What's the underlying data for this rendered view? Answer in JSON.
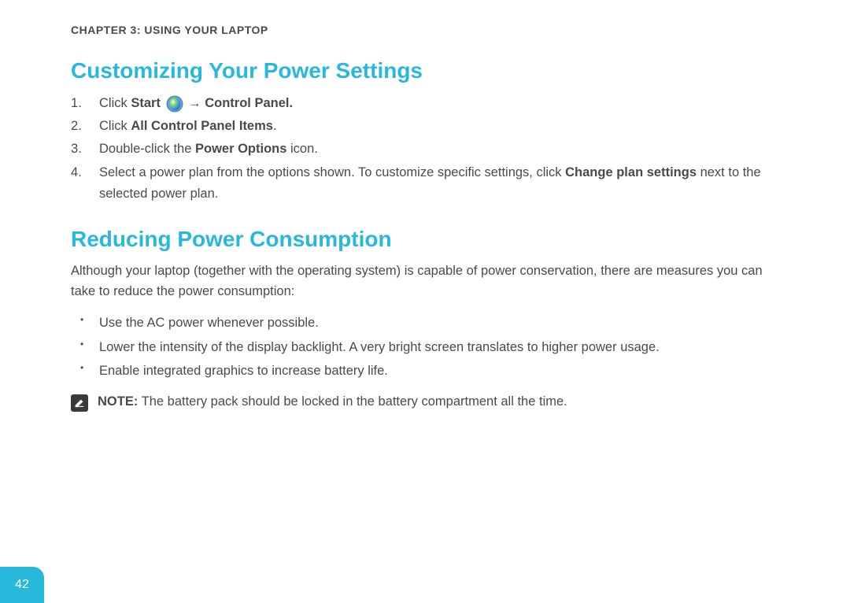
{
  "chapter_header": "CHAPTER 3: USING YOUR LAPTOP",
  "section1": {
    "title": "Customizing Your Power Settings",
    "step1": {
      "prefix": "Click ",
      "bold1": "Start",
      "arrow": " → ",
      "bold2": "Control Panel."
    },
    "step2": {
      "prefix": "Click ",
      "bold": "All Control Panel Items",
      "suffix": "."
    },
    "step3": {
      "prefix": "Double-click the ",
      "bold": "Power Options",
      "suffix": " icon."
    },
    "step4": {
      "prefix": "Select a power plan from the options shown. To customize specific settings, click ",
      "bold": "Change plan settings",
      "suffix": " next to the selected power plan."
    }
  },
  "section2": {
    "title": "Reducing Power Consumption",
    "intro": "Although your laptop (together with the operating system) is capable of power conservation, there are measures you can take to reduce the power consumption:",
    "bullets": [
      "Use the AC power whenever possible.",
      "Lower the intensity of the display backlight. A very bright screen translates to higher power usage.",
      "Enable integrated graphics to increase battery life."
    ],
    "note": {
      "label": "NOTE:",
      "text": " The battery pack should be locked in the battery compartment all the time."
    }
  },
  "page_number": "42"
}
